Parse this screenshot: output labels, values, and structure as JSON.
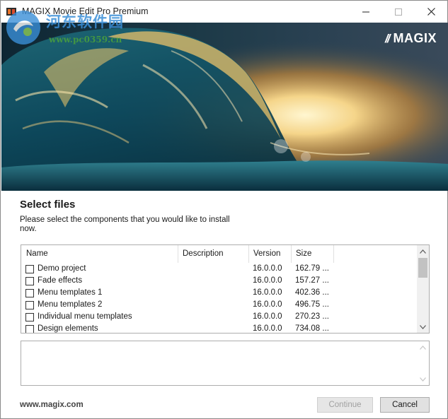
{
  "window": {
    "title": "MAGIX Movie Edit Pro Premium",
    "controls": [
      "minimize",
      "maximize",
      "close"
    ]
  },
  "watermark": {
    "line1": "河东软件园",
    "line2": "www.pc0359.cn"
  },
  "banner": {
    "brand": "MAGIX",
    "brand_mark": "//"
  },
  "page": {
    "heading": "Select files",
    "instructions": "Please select the components that you would like to install now."
  },
  "components": {
    "columns": [
      "Name",
      "Description",
      "Version",
      "Size"
    ],
    "rows": [
      {
        "name": "Demo project",
        "description": "",
        "version": "16.0.0.0",
        "size": "162.79 ...",
        "checked": false
      },
      {
        "name": "Fade effects",
        "description": "",
        "version": "16.0.0.0",
        "size": "157.27 ...",
        "checked": false
      },
      {
        "name": "Menu templates 1",
        "description": "",
        "version": "16.0.0.0",
        "size": "402.36 ...",
        "checked": false
      },
      {
        "name": "Menu templates 2",
        "description": "",
        "version": "16.0.0.0",
        "size": "496.75 ...",
        "checked": false
      },
      {
        "name": "Individual menu templates",
        "description": "",
        "version": "16.0.0.0",
        "size": "270.23 ...",
        "checked": false
      },
      {
        "name": "Design elements",
        "description": "",
        "version": "16.0.0.0",
        "size": "734.08 ...",
        "checked": false
      }
    ]
  },
  "description_panel": {
    "text": ""
  },
  "footer": {
    "link": "www.magix.com",
    "continue_label": "Continue",
    "cancel_label": "Cancel"
  },
  "colors": {
    "banner_sky": "#1b3142",
    "wave_light": "#f2d48a",
    "wave_dark": "#0d4a5e",
    "watermark_blue": "#3a8fd8",
    "watermark_green": "#4aa03c"
  },
  "icons": {
    "app": "magix-app-icon",
    "minimize": "minimize-icon",
    "maximize": "maximize-icon",
    "close": "close-icon",
    "scroll_up": "chevron-up-icon",
    "scroll_down": "chevron-down-icon"
  }
}
